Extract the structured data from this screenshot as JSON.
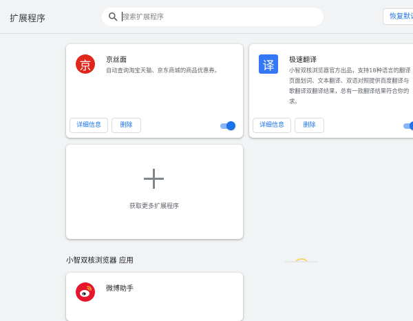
{
  "header": {
    "title": "扩展程序",
    "search_placeholder": "搜索扩展程序",
    "restore_label": "恢复默认"
  },
  "extensions": [
    {
      "name": "京丝面",
      "logo_char": "京",
      "logo_color": "#e1251b",
      "description_lines": [
        "自动查询淘宝天猫、京东商城的商品优惠券。"
      ],
      "details_label": "详细信息",
      "remove_label": "删除",
      "enabled": true
    },
    {
      "name": "极速翻译",
      "logo_char": "译",
      "logo_color": "#3478f6",
      "description_lines": [
        "小智双核浏览器官方出品，支持18种语言的翻译",
        "页面划词、文本翻译、双语对照提供百度翻译与",
        "歌翻译双翻译结果，总有一款翻译结果符合你的",
        "求。"
      ],
      "details_label": "详细信息",
      "remove_label": "删除",
      "enabled": true
    }
  ],
  "get_more": {
    "label": "获取更多扩展程序"
  },
  "apps_section": {
    "title": "小智双核浏览器 应用",
    "apps": [
      {
        "name": "微博助手"
      }
    ]
  },
  "colors": {
    "accent": "#1a73e8",
    "background": "#f1f3f4",
    "card": "#ffffff"
  }
}
